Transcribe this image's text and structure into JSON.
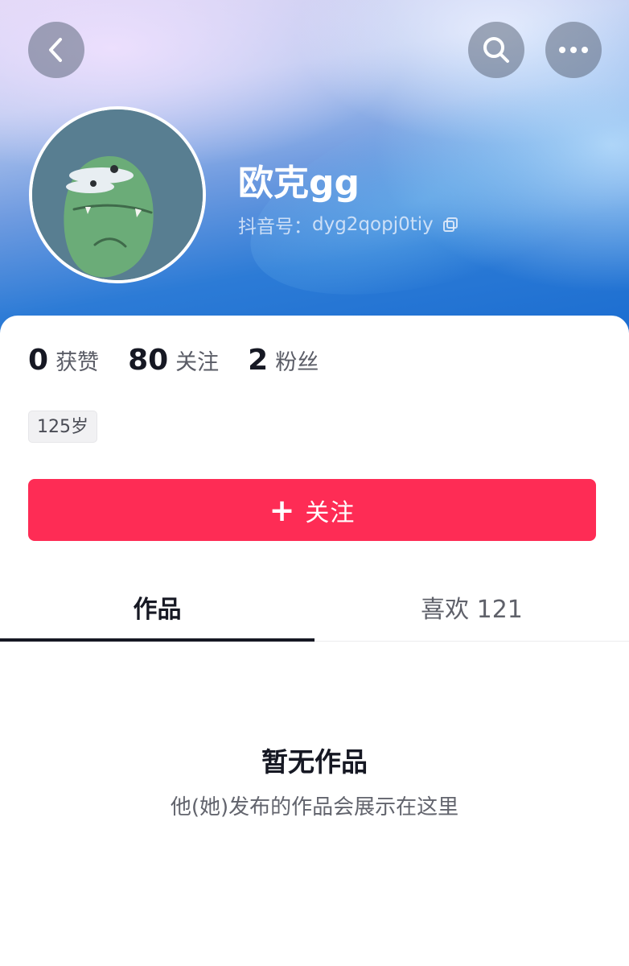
{
  "header": {
    "back_icon": "chevron-left-icon",
    "search_icon": "search-icon",
    "more_icon": "more-dots-icon"
  },
  "profile": {
    "name": "欧克gg",
    "douyin_id_label": "抖音号：",
    "douyin_id": "dyg2qopj0tiy",
    "copy_icon": "copy-icon",
    "avatar_icon": "green-monster-avatar"
  },
  "stats": [
    {
      "value": "0",
      "label": "获赞"
    },
    {
      "value": "80",
      "label": "关注"
    },
    {
      "value": "2",
      "label": "粉丝"
    }
  ],
  "tags": {
    "age": "125岁"
  },
  "follow_button": {
    "plus": "+",
    "label": "关注"
  },
  "tabs": [
    {
      "label": "作品",
      "active": true
    },
    {
      "label": "喜欢 121",
      "active": false
    }
  ],
  "empty_state": {
    "title": "暂无作品",
    "subtitle": "他(她)发布的作品会展示在这里"
  },
  "colors": {
    "accent": "#fe2c55",
    "text_primary": "#161823",
    "text_secondary": "#5a5c66"
  }
}
